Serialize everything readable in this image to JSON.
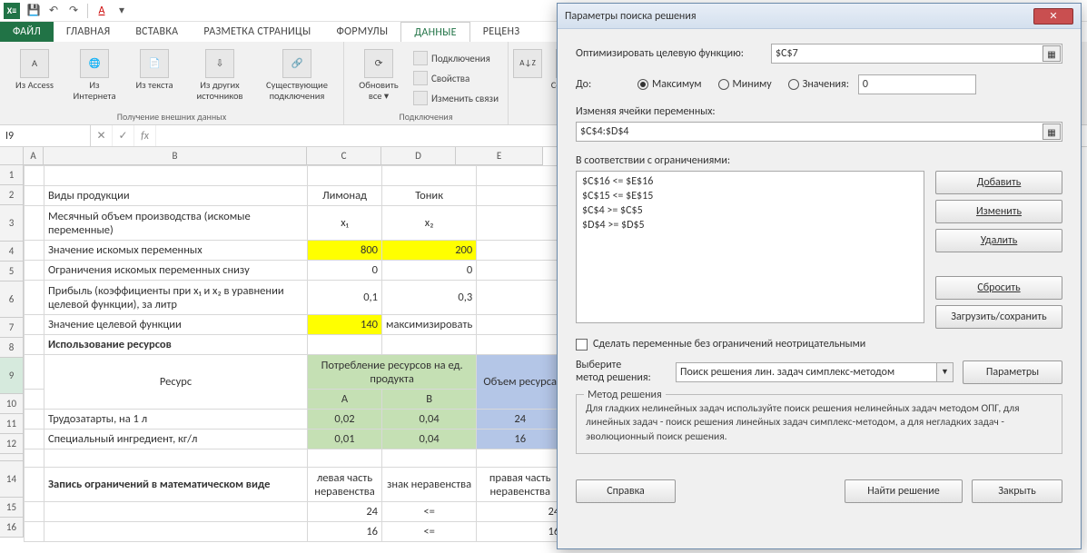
{
  "qat": {
    "undo": "↶",
    "redo": "↷"
  },
  "tabs": {
    "file": "ФАЙЛ",
    "home": "ГЛАВНАЯ",
    "insert": "ВСТАВКА",
    "layout": "РАЗМЕТКА СТРАНИЦЫ",
    "formulas": "ФОРМУЛЫ",
    "data": "ДАННЫЕ",
    "review": "РЕЦЕНЗ"
  },
  "ribbon": {
    "access": "Из Access",
    "web": "Из Интернета",
    "text": "Из текста",
    "other": "Из других источников",
    "existing": "Существующие подключения",
    "refresh": "Обновить все ▾",
    "connections": "Подключения",
    "properties": "Свойства",
    "editlinks": "Изменить связи",
    "sort": "Сортиров",
    "group1": "Получение внешних данных",
    "group2": "Подключения"
  },
  "namebox": "I9",
  "fx": "fx",
  "cols": {
    "A": "A",
    "B": "B",
    "C": "C",
    "D": "D",
    "E": "E"
  },
  "rows": {
    "r2": {
      "b": "Виды продукции",
      "c": "Лимонад",
      "d": "Тоник"
    },
    "r3": {
      "b": "Месячный объем производства (искомые переменные)",
      "c": "x₁",
      "d": "x₂"
    },
    "r4": {
      "b": "Значение искомых переменных",
      "c": "800",
      "d": "200"
    },
    "r5": {
      "b": "Ограничения искомых переменных снизу",
      "c": "0",
      "d": "0"
    },
    "r6": {
      "b": "Прибыль (коэффициенты при x₁ и x₂ в уравнении целевой функции), за литр",
      "c": "0,1",
      "d": "0,3"
    },
    "r7": {
      "b": "Значение целевой функции",
      "c": "140",
      "d": "максимизировать"
    },
    "r8": {
      "b": "Использование ресурсов"
    },
    "r9": {
      "b": "Ресурс",
      "cd": "Потребление ресурсов на ед. продукта",
      "e": "Объем ресурса"
    },
    "r10": {
      "c": "A",
      "d": "B"
    },
    "r11": {
      "b": "Трудозатарты, на 1 л",
      "c": "0,02",
      "d": "0,04",
      "e": "24"
    },
    "r12": {
      "b": "Специальный ингредиент, кг/л",
      "c": "0,01",
      "d": "0,04",
      "e": "16"
    },
    "r14": {
      "b": "Запись ограничений в математическом виде",
      "c": "левая часть неравенства",
      "d": "знак неравенства",
      "e": "правая часть неравенства"
    },
    "r15": {
      "c": "24",
      "d": "<=",
      "e": "24"
    },
    "r16": {
      "c": "16",
      "d": "<=",
      "e": "16"
    }
  },
  "dialog": {
    "title": "Параметры поиска решения",
    "optimize_lbl": "Оптимизировать целевую функцию:",
    "optimize_val": "$C$7",
    "to_lbl": "До:",
    "max": "Максимум",
    "min": "Миниму",
    "val": "Значения:",
    "val_input": "0",
    "vars_lbl": "Изменяя ячейки переменных:",
    "vars_val": "$C$4:$D$4",
    "constr_lbl": "В соответствии с ограничениями:",
    "constraints": [
      "$C$16 <= $E$16",
      "$C$15 <= $E$15",
      "$C$4 >= $C$5",
      "$D$4 >= $D$5"
    ],
    "add": "Добавить",
    "change": "Изменить",
    "delete": "Удалить",
    "reset": "Сбросить",
    "loadsave": "Загрузить/сохранить",
    "nonneg": "Сделать переменные без ограничений неотрицательными",
    "method_lbl1": "Выберите",
    "method_lbl2": "метод решения:",
    "method_val": "Поиск решения лин. задач симплекс-методом",
    "params": "Параметры",
    "fs_title": "Метод решения",
    "fs_text": "Для гладких нелинейных задач используйте поиск решения нелинейных задач методом ОПГ, для линейных задач - поиск решения линейных задач симплекс-методом, а для негладких задач - эволюционный поиск решения.",
    "help": "Справка",
    "solve": "Найти решение",
    "close": "Закрыть"
  }
}
